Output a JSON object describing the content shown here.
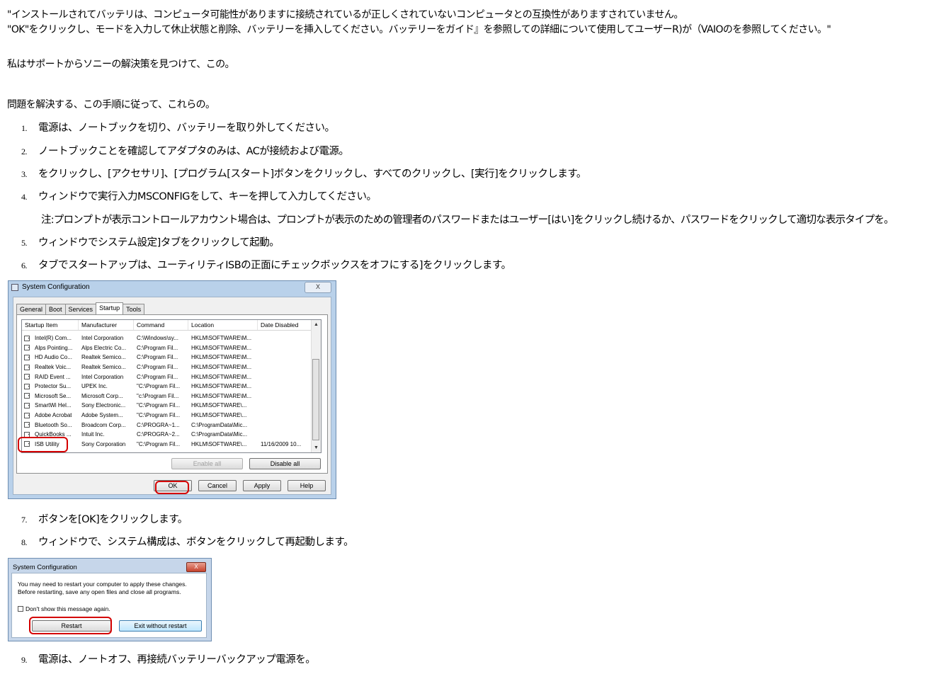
{
  "intro": {
    "line1": "\"インストールされてバッテリは、コンピュータ可能性がありますに接続されているが正しくされていないコンピュータとの互換性がありますされていません。",
    "line2": "\"OK\"をクリックし、モードを入力して休止状態と削除、バッテリーを挿入してください。バッテリーをガイド』を参照しての詳細について使用してユーザーR)が（VAIOのを参照してください。\"",
    "line3": "私はサポートからソニーの解決策を見つけて、この。",
    "line4": "問題を解決する、この手順に従って、これらの。"
  },
  "steps": [
    {
      "num": "1.",
      "text": "電源は、ノートブックを切り、バッテリーを取り外してください。"
    },
    {
      "num": "2.",
      "text": "ノートブックことを確認してアダプタのみは、ACが接続および電源。"
    },
    {
      "num": "3.",
      "text": "をクリックし、[アクセサリ]、[プログラム[スタート]ボタンをクリックし、すべてのクリックし、[実行]をクリックします。"
    },
    {
      "num": "4.",
      "text": "ウィンドウで実行入力MSCONFIGをして、キーを押して入力してください。"
    },
    {
      "num": "5.",
      "text": "ウィンドウでシステム設定]タブをクリックして起動。"
    },
    {
      "num": "6.",
      "text": "タブでスタートアップは、ユーティリティISBの正面にチェックボックスをオフにする]をクリックします。"
    },
    {
      "num": "7.",
      "text": "ボタンを[OK]をクリックします。"
    },
    {
      "num": "8.",
      "text": "ウィンドウで、システム構成は、ボタンをクリックして再起動します。"
    },
    {
      "num": "9.",
      "text": "電源は、ノートオフ、再接続バッテリーバックアップ電源を。"
    }
  ],
  "note": "注:プロンプトが表示コントロールアカウント場合は、プロンプトが表示のための管理者のパスワードまたはユーザー[はい]をクリックし続けるか、パスワードをクリックして適切な表示タイプを。",
  "sysconfig": {
    "title": "System Configuration",
    "close": "X",
    "tabs": [
      "General",
      "Boot",
      "Services",
      "Startup",
      "Tools"
    ],
    "columns": [
      "Startup Item",
      "Manufacturer",
      "Command",
      "Location",
      "Date Disabled"
    ],
    "rows": [
      {
        "item": "Intel(R) Com...",
        "mfr": "Intel Corporation",
        "cmd": "C:\\Windows\\sy...",
        "loc": "HKLM\\SOFTWARE\\M...",
        "date": ""
      },
      {
        "item": "Alps Pointing...",
        "mfr": "Alps Electric Co...",
        "cmd": "C:\\Program Fil...",
        "loc": "HKLM\\SOFTWARE\\M...",
        "date": ""
      },
      {
        "item": "HD Audio Co...",
        "mfr": "Realtek Semico...",
        "cmd": "C:\\Program Fil...",
        "loc": "HKLM\\SOFTWARE\\M...",
        "date": ""
      },
      {
        "item": "Realtek Voic...",
        "mfr": "Realtek Semico...",
        "cmd": "C:\\Program Fil...",
        "loc": "HKLM\\SOFTWARE\\M...",
        "date": ""
      },
      {
        "item": "RAID Event ...",
        "mfr": "Intel Corporation",
        "cmd": "C:\\Program Fil...",
        "loc": "HKLM\\SOFTWARE\\M...",
        "date": ""
      },
      {
        "item": "Protector Su...",
        "mfr": "UPEK Inc.",
        "cmd": "\"C:\\Program Fil...",
        "loc": "HKLM\\SOFTWARE\\M...",
        "date": ""
      },
      {
        "item": "Microsoft Se...",
        "mfr": "Microsoft Corp...",
        "cmd": "\"c:\\Program Fil...",
        "loc": "HKLM\\SOFTWARE\\M...",
        "date": ""
      },
      {
        "item": "SmartWi Hel...",
        "mfr": "Sony Electronic...",
        "cmd": "\"C:\\Program Fil...",
        "loc": "HKLM\\SOFTWARE\\...",
        "date": ""
      },
      {
        "item": "Adobe Acrobat",
        "mfr": "Adobe System...",
        "cmd": "\"C:\\Program Fil...",
        "loc": "HKLM\\SOFTWARE\\...",
        "date": ""
      },
      {
        "item": "Bluetooth So...",
        "mfr": "Broadcom Corp...",
        "cmd": "C:\\PROGRA~1...",
        "loc": "C:\\ProgramData\\Mic...",
        "date": ""
      },
      {
        "item": "QuickBooks ...",
        "mfr": "Intuit Inc.",
        "cmd": "C:\\PROGRA~2...",
        "loc": "C:\\ProgramData\\Mic...",
        "date": ""
      },
      {
        "item": "ISB Utility",
        "mfr": "Sony Corporation",
        "cmd": "\"C:\\Program Fil...",
        "loc": "HKLM\\SOFTWARE\\...",
        "date": "11/16/2009 10..."
      }
    ],
    "check_mark": "✓",
    "scroll_up": "▲",
    "scroll_down": "▼",
    "enable_all": "Enable all",
    "disable_all": "Disable all",
    "ok": "OK",
    "cancel": "Cancel",
    "apply": "Apply",
    "help": "Help"
  },
  "restart": {
    "title": "System Configuration",
    "close": "X",
    "message1": "You may need to restart your computer to apply these changes.",
    "message2": "Before restarting, save any open files and close all programs.",
    "dont_show": "Don't show this message again.",
    "restart_btn": "Restart",
    "exit_btn": "Exit without restart"
  }
}
